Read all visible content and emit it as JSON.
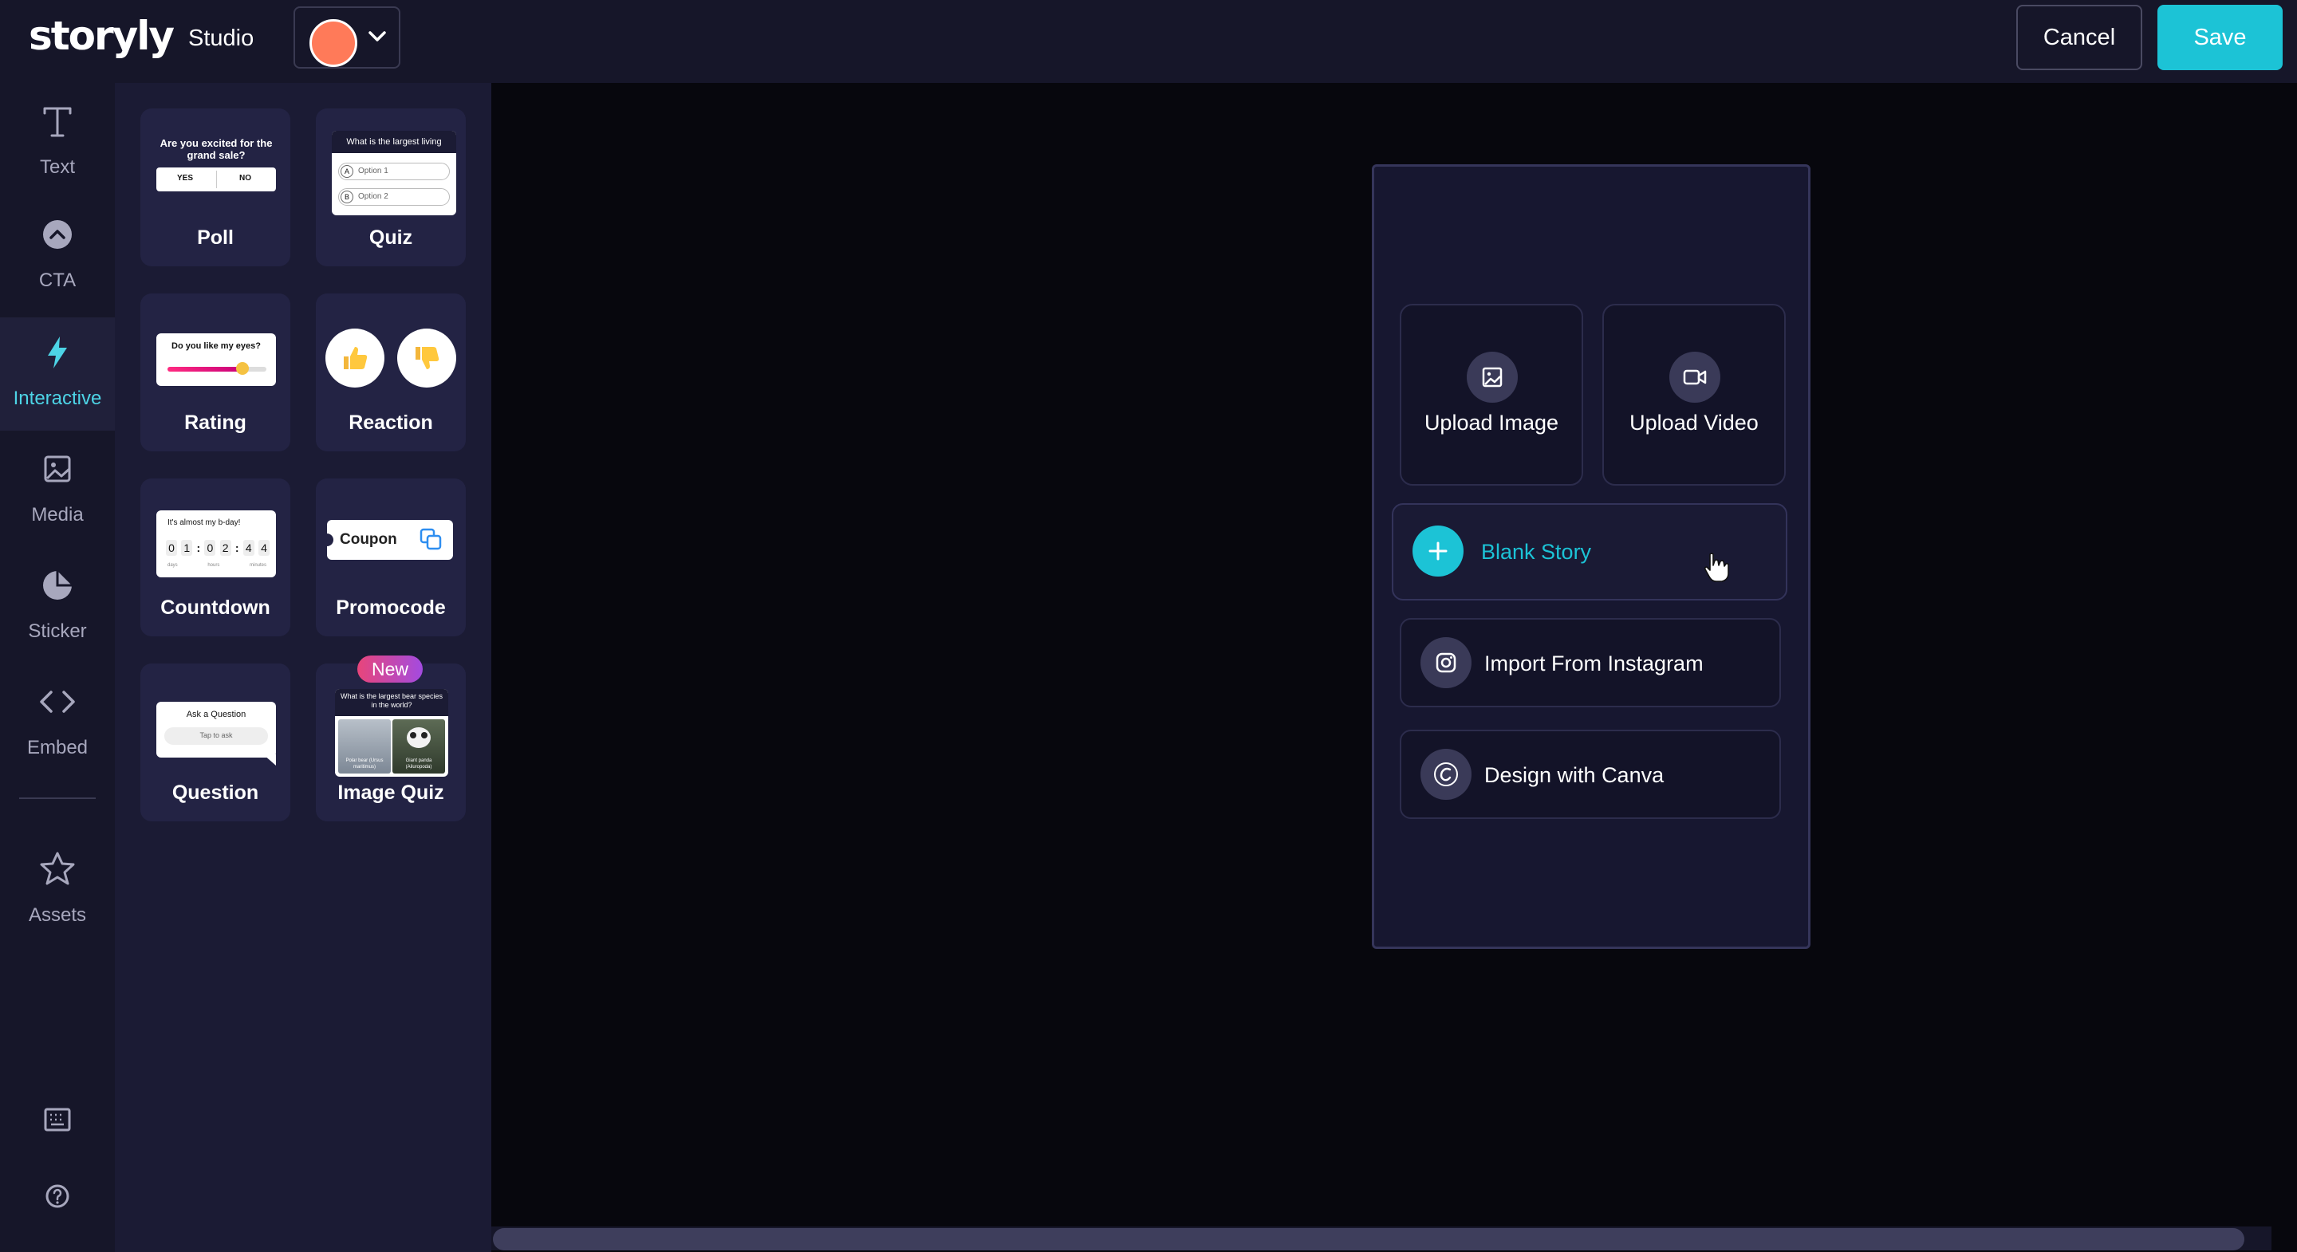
{
  "brand": {
    "logo_text": "storyly",
    "product": "Studio",
    "accent": "#1cc3d6",
    "theme_swatch": "#ff7a59",
    "new_badge_color": "#e8457a"
  },
  "header": {
    "cancel_label": "Cancel",
    "save_label": "Save"
  },
  "nav": {
    "items": [
      {
        "label": "Text",
        "icon": "text-icon"
      },
      {
        "label": "CTA",
        "icon": "cta-icon"
      },
      {
        "label": "Interactive",
        "icon": "lightning-icon",
        "active": true
      },
      {
        "label": "Media",
        "icon": "image-icon"
      },
      {
        "label": "Sticker",
        "icon": "sticker-icon"
      },
      {
        "label": "Embed",
        "icon": "code-icon"
      },
      {
        "label": "Assets",
        "icon": "star-icon"
      }
    ],
    "bottom": [
      {
        "icon": "keyboard-icon"
      },
      {
        "icon": "help-icon"
      }
    ]
  },
  "panel": {
    "cards": [
      {
        "label": "Poll",
        "thumb_title": "Are you excited for the grand sale?",
        "opt_yes": "YES",
        "opt_no": "NO"
      },
      {
        "label": "Quiz",
        "thumb_title": "What is the largest living",
        "opt1": "Option 1",
        "opt2": "Option 2",
        "opt1_letter": "A",
        "opt2_letter": "B"
      },
      {
        "label": "Rating",
        "thumb_title": "Do you like my eyes?"
      },
      {
        "label": "Reaction"
      },
      {
        "label": "Countdown",
        "thumb_title": "It's almost my b-day!",
        "digits": [
          "0",
          "1",
          ":",
          "0",
          "2",
          ":",
          "4",
          "4"
        ],
        "units": [
          "days",
          "hours",
          "minutes"
        ]
      },
      {
        "label": "Promocode",
        "thumb_text": "Coupon"
      },
      {
        "label": "Question",
        "thumb_title": "Ask a Question",
        "thumb_hint": "Tap to ask"
      },
      {
        "label": "Image Quiz",
        "badge": "New",
        "thumb_title": "What is the largest bear species in the world?",
        "img1_caption": "Polar bear (Ursus maritimus)",
        "img2_caption": "Giant panda (Ailuropoda)"
      }
    ]
  },
  "story": {
    "upload_image": "Upload Image",
    "upload_video": "Upload Video",
    "blank_story": "Blank Story",
    "import_instagram": "Import From Instagram",
    "design_canva": "Design with Canva"
  }
}
